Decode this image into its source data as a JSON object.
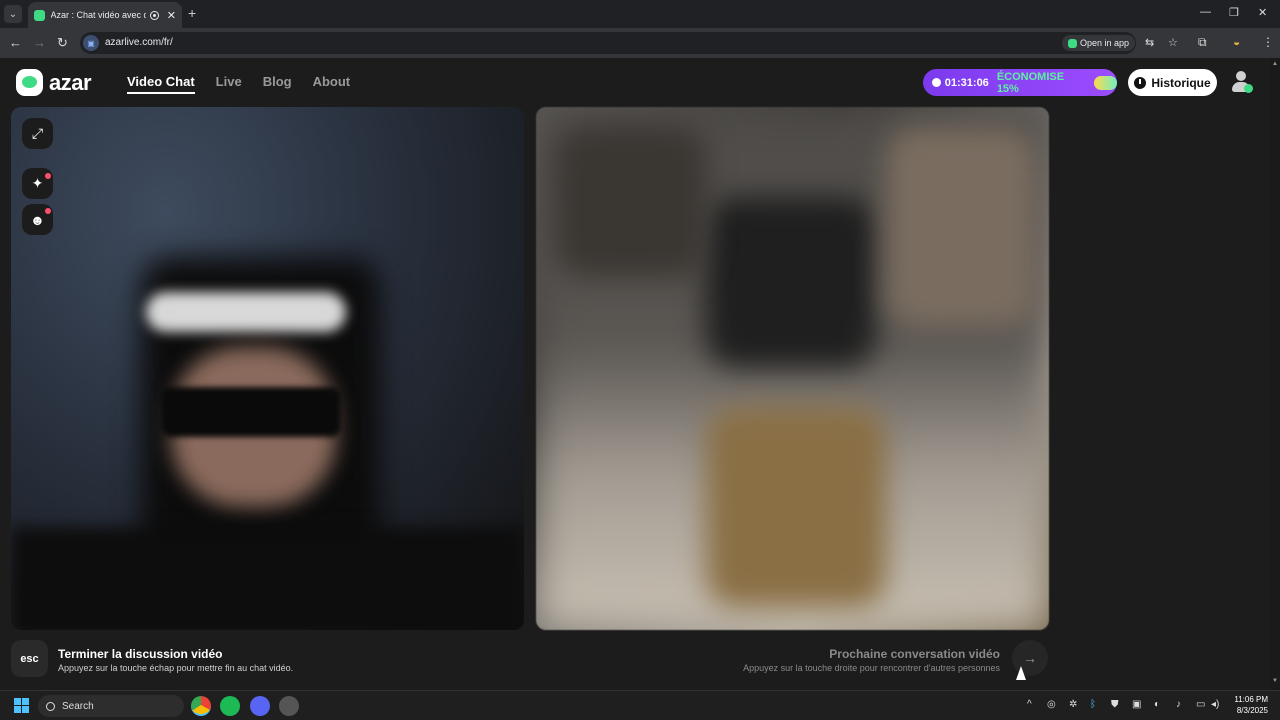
{
  "browser": {
    "tab_title": "Azar : Chat vidéo avec de n",
    "tab_close": "✕",
    "new_tab": "+",
    "url": "azarlive.com/fr/",
    "open_in_app": "Open in app"
  },
  "header": {
    "logo_text": "azar",
    "nav": [
      "Video Chat",
      "Live",
      "Blog",
      "About"
    ],
    "promo_timer": "01:31:06",
    "promo_label": "ÉCONOMISE 15%",
    "history_label": "Historique"
  },
  "footer": {
    "esc_key": "esc",
    "end_title": "Terminer la discussion vidéo",
    "end_hint": "Appuyez sur la touche échap pour mettre fin au chat vidéo.",
    "next_title": "Prochaine conversation vidéo",
    "next_hint": "Appuyez sur la touche droite pour rencontrer d'autres personnes",
    "next_arrow": "→"
  },
  "taskbar": {
    "search_placeholder": "Search",
    "time": "11:06 PM",
    "date": "8/3/2025"
  },
  "colors": {
    "brand_green": "#3ddc84",
    "promo_purple": "#7c3aed",
    "notification_red": "#ff4d6d"
  },
  "icons": [
    "expand-icon",
    "sparkle-effects-icon",
    "sticker-face-icon",
    "clock-icon",
    "user-avatar-icon",
    "arrow-right-icon"
  ]
}
